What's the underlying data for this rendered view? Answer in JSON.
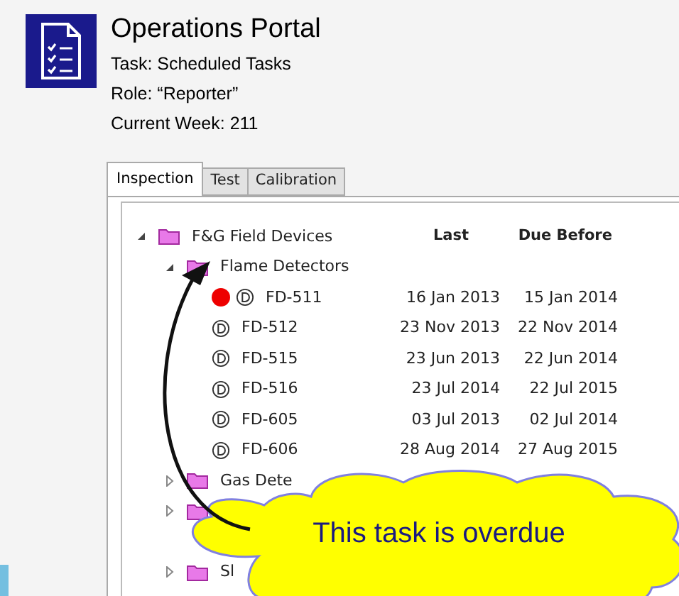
{
  "header": {
    "title": "Operations Portal",
    "lines": [
      "Task: Scheduled Tasks",
      "Role: “Reporter”",
      "Current Week: 211"
    ]
  },
  "tabs": [
    {
      "label": "Inspection",
      "selected": true
    },
    {
      "label": "Test",
      "selected": false
    },
    {
      "label": "Calibration",
      "selected": false
    }
  ],
  "tree": {
    "columns": [
      "Last",
      "Due Before"
    ],
    "items": [
      {
        "kind": "folder",
        "label": "F&G Field Devices",
        "expanded": true,
        "children": [
          {
            "kind": "folder",
            "label": "Flame Detectors",
            "expanded": true,
            "children": [
              {
                "kind": "device",
                "label": "FD-511",
                "overdue": true,
                "last": "16 Jan 2013",
                "due_before": "15 Jan 2014"
              },
              {
                "kind": "device",
                "label": "FD-512",
                "overdue": false,
                "last": "23 Nov 2013",
                "due_before": "22 Nov 2014"
              },
              {
                "kind": "device",
                "label": "FD-515",
                "overdue": false,
                "last": "23 Jun 2013",
                "due_before": "22 Jun 2014"
              },
              {
                "kind": "device",
                "label": "FD-516",
                "overdue": false,
                "last": "23 Jul 2014",
                "due_before": "22 Jul 2015"
              },
              {
                "kind": "device",
                "label": "FD-605",
                "overdue": false,
                "last": "03 Jul 2013",
                "due_before": "02 Jul 2014"
              },
              {
                "kind": "device",
                "label": "FD-606",
                "overdue": false,
                "last": "28 Aug 2014",
                "due_before": "27 Aug 2015"
              }
            ]
          },
          {
            "kind": "folder",
            "label": "Gas Dete",
            "expanded": false
          },
          {
            "kind": "folder",
            "expanded": false
          },
          {
            "kind": "folder",
            "label": "Sl",
            "expanded": false
          }
        ]
      }
    ]
  },
  "callout": {
    "text": "This task is overdue"
  }
}
